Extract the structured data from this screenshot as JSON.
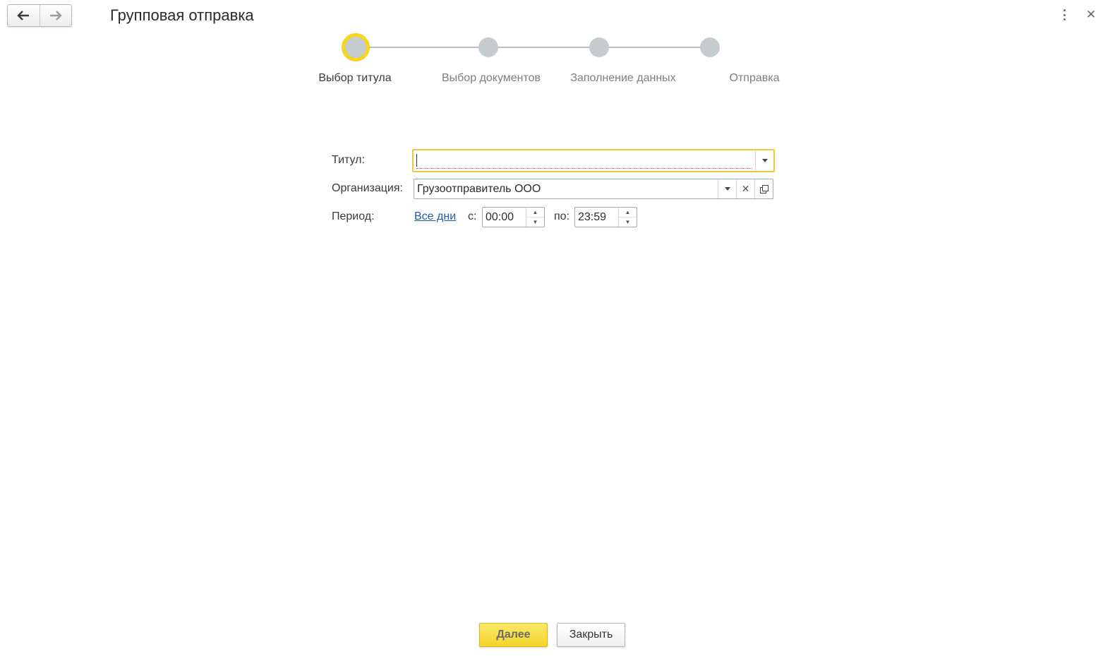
{
  "window": {
    "title": "Групповая отправка"
  },
  "stepper": {
    "active_color": "#f6d51a",
    "steps": [
      {
        "label": "Выбор титула",
        "active": true
      },
      {
        "label": "Выбор документов",
        "active": false
      },
      {
        "label": "Заполнение данных",
        "active": false
      },
      {
        "label": "Отправка",
        "active": false
      }
    ]
  },
  "form": {
    "title_field": {
      "label": "Титул:",
      "value": ""
    },
    "organization_field": {
      "label": "Организация:",
      "value": "Грузоотправитель ООО"
    },
    "period": {
      "label": "Период:",
      "link_text": "Все дни",
      "from_label": "с:",
      "from_value": "00:00",
      "to_label": "по:",
      "to_value": "23:59"
    }
  },
  "buttons": {
    "next_label": "Далее",
    "close_label": "Закрыть"
  },
  "icons": {
    "back": "arrow-left-icon",
    "forward": "arrow-right-icon",
    "more": "more-vertical-icon",
    "close": "close-icon",
    "dropdown": "chevron-down-icon",
    "clear": "clear-icon",
    "open": "open-window-icon"
  }
}
